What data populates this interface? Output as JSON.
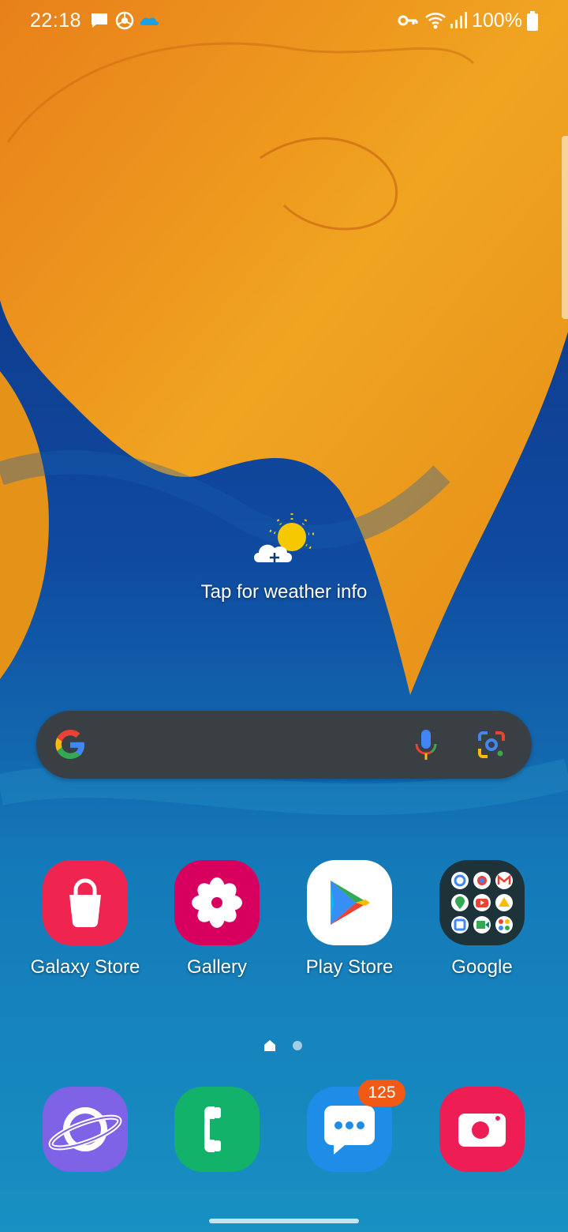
{
  "status_bar": {
    "time": "22:18",
    "battery": "100%",
    "left_icons": [
      "message-icon",
      "chrome-like-icon",
      "cloud-icon"
    ],
    "right_icons": [
      "key-icon",
      "wifi-icon",
      "signal-icon",
      "battery-icon"
    ]
  },
  "weather": {
    "text": "Tap for weather info",
    "icon": "weather-sun-cloud-icon"
  },
  "search": {
    "icons": [
      "google-g-icon",
      "mic-icon",
      "lens-icon"
    ]
  },
  "apps": [
    {
      "label": "Galaxy Store",
      "icon": "galaxy-store-icon",
      "color": "#f0254f"
    },
    {
      "label": "Gallery",
      "icon": "gallery-icon",
      "color": "#d7005f"
    },
    {
      "label": "Play Store",
      "icon": "play-store-icon",
      "color": "#ffffff"
    },
    {
      "label": "Google",
      "icon": "google-folder-icon",
      "color": "#1d3339"
    }
  ],
  "page_indicator": {
    "pages": 2,
    "current": 1
  },
  "dock": [
    {
      "name": "Internet",
      "icon": "internet-icon",
      "color": "#7e63e6"
    },
    {
      "name": "Phone",
      "icon": "phone-icon",
      "color": "#13b26a"
    },
    {
      "name": "Messages",
      "icon": "messages-icon",
      "color": "#1d8de8",
      "badge": "125"
    },
    {
      "name": "Camera",
      "icon": "camera-icon",
      "color": "#ee1e55"
    }
  ]
}
